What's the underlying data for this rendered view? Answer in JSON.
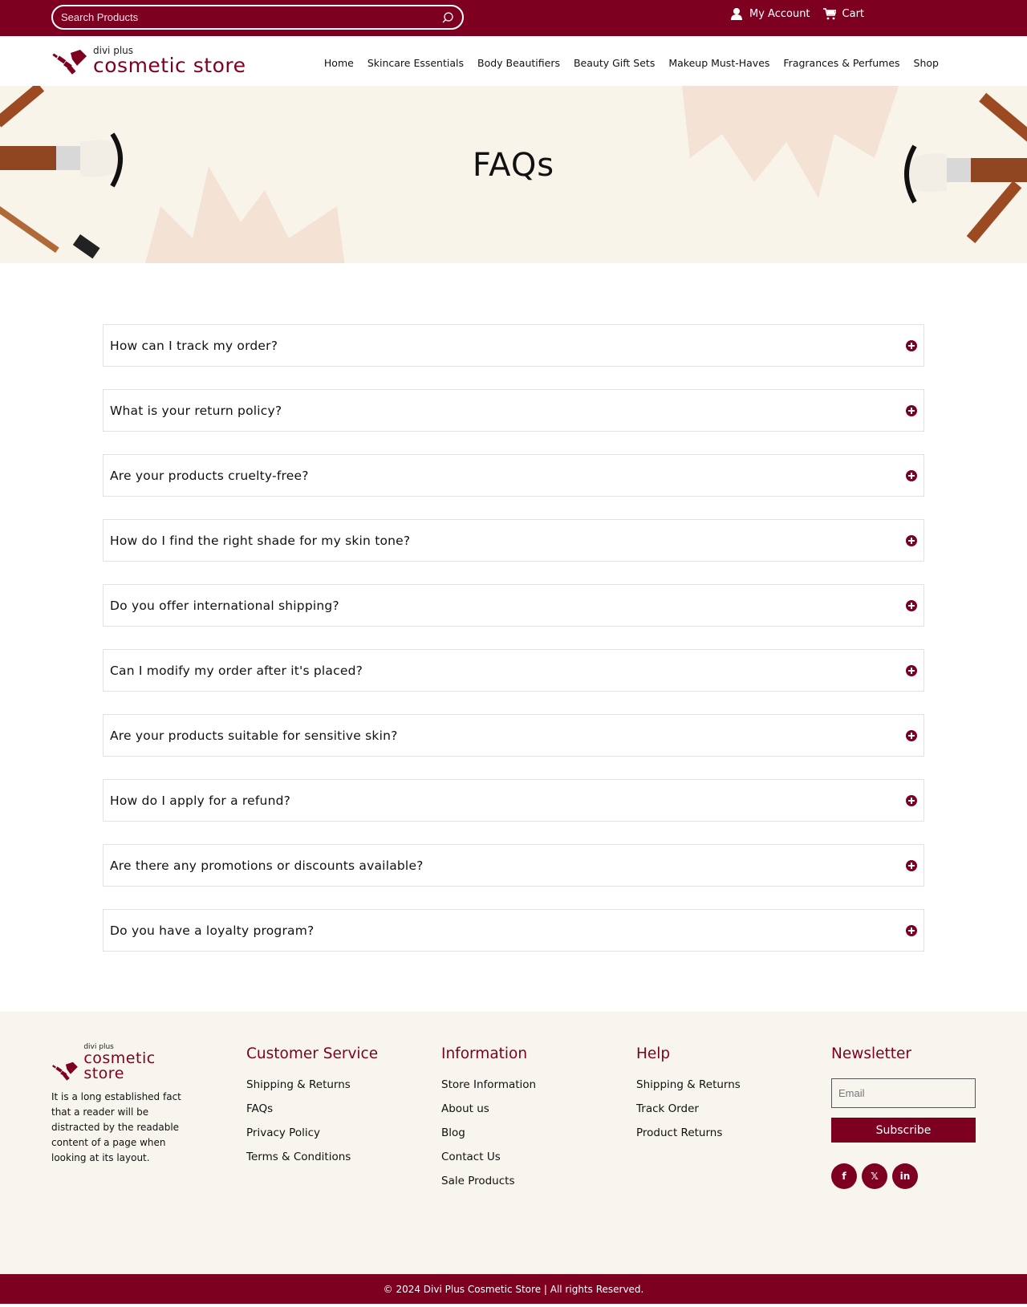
{
  "topbar": {
    "search_placeholder": "Search Products",
    "my_account": "My Account",
    "cart": "Cart"
  },
  "brand": {
    "small": "divi plus",
    "big": "cosmetic store",
    "color": "#7e0021"
  },
  "nav": [
    {
      "label": "Home"
    },
    {
      "label": "Skincare Essentials"
    },
    {
      "label": "Body Beautifiers"
    },
    {
      "label": "Beauty Gift Sets"
    },
    {
      "label": "Makeup Must-Haves"
    },
    {
      "label": "Fragrances & Perfumes"
    },
    {
      "label": "Shop"
    }
  ],
  "hero": {
    "title": "FAQs"
  },
  "faqs": [
    {
      "question": "How can I track my order?"
    },
    {
      "question": "What is your return policy?"
    },
    {
      "question": "Are your products cruelty-free?"
    },
    {
      "question": "How do I find the right shade for my skin tone?"
    },
    {
      "question": "Do you offer international shipping?"
    },
    {
      "question": "Can I modify my order after it's placed?"
    },
    {
      "question": "Are your products suitable for sensitive skin?"
    },
    {
      "question": "How do I apply for a refund?"
    },
    {
      "question": "Are there any promotions or discounts available?"
    },
    {
      "question": "Do you have a loyalty program?"
    }
  ],
  "footer": {
    "about": "It is a long established fact that a reader will be distracted by the readable content of a page when looking at its layout.",
    "customer_service": {
      "title": "Customer Service",
      "links": [
        "Shipping & Returns",
        "FAQs",
        "Privacy Policy",
        "Terms & Conditions"
      ]
    },
    "information": {
      "title": "Information",
      "links": [
        "Store Information",
        "About us",
        "Blog",
        "Contact Us",
        "Sale Products"
      ]
    },
    "help": {
      "title": "Help",
      "links": [
        "Shipping & Returns",
        "Track Order",
        "Product Returns"
      ]
    },
    "newsletter": {
      "title": "Newsletter",
      "email_placeholder": "Email",
      "subscribe": "Subscribe",
      "social": [
        {
          "icon": "facebook-icon",
          "glyph": "f"
        },
        {
          "icon": "x-icon",
          "glyph": "𝕏"
        },
        {
          "icon": "linkedin-icon",
          "glyph": "in"
        }
      ]
    },
    "copyright": "© 2024 Divi Plus Cosmetic Store | All rights Reserved."
  }
}
